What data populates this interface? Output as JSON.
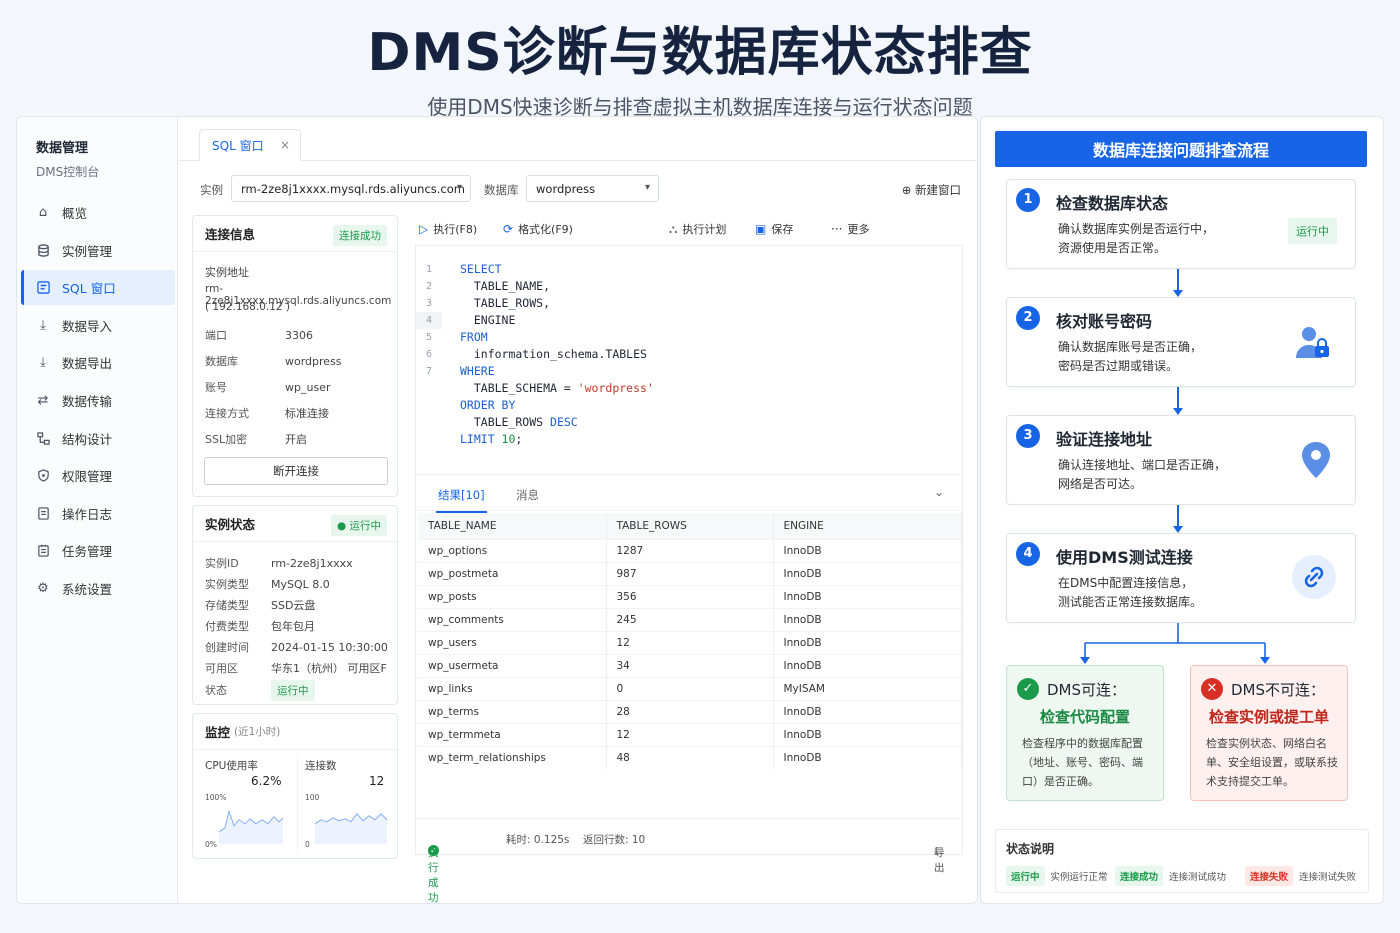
{
  "header": {
    "title": "DMS诊断与数据库状态排查",
    "subtitle": "使用DMS快速诊断与排查虚拟主机数据库连接与运行状态问题"
  },
  "sidebar": {
    "title": "数据管理",
    "subtitle": "DMS控制台",
    "items": [
      {
        "label": "概览",
        "icon": "home-icon"
      },
      {
        "label": "实例管理",
        "icon": "database-icon"
      },
      {
        "label": "SQL 窗口",
        "icon": "sql-window-icon",
        "active": true
      },
      {
        "label": "数据导入",
        "icon": "import-icon"
      },
      {
        "label": "数据导出",
        "icon": "export-icon"
      },
      {
        "label": "数据传输",
        "icon": "transfer-icon"
      },
      {
        "label": "结构设计",
        "icon": "structure-icon"
      },
      {
        "label": "权限管理",
        "icon": "permission-icon"
      },
      {
        "label": "操作日志",
        "icon": "log-icon"
      },
      {
        "label": "任务管理",
        "icon": "task-icon"
      },
      {
        "label": "系统设置",
        "icon": "gear-icon"
      }
    ]
  },
  "tab": {
    "label": "SQL 窗口",
    "close": "×"
  },
  "selectors": {
    "instance_label": "实例",
    "instance_value": "rm-2ze8j1xxxx.mysql.rds.aliyuncs.com",
    "db_label": "数据库",
    "db_value": "wordpress",
    "new_window": "新建窗口"
  },
  "connection": {
    "title": "连接信息",
    "badge": "连接成功",
    "addr_label": "实例地址",
    "addr_value": "rm-2ze8j1xxxx.mysql.rds.aliyuncs.com",
    "addr_ip": "( 192.168.0.12 )",
    "rows": [
      {
        "k": "端口",
        "v": "3306"
      },
      {
        "k": "数据库",
        "v": "wordpress"
      },
      {
        "k": "账号",
        "v": "wp_user"
      },
      {
        "k": "连接方式",
        "v": "标准连接"
      },
      {
        "k": "SSL加密",
        "v": "开启"
      }
    ],
    "disconnect": "断开连接"
  },
  "instance_status": {
    "title": "实例状态",
    "badge": "运行中",
    "rows": [
      {
        "k": "实例ID",
        "v": "rm-2ze8j1xxxx"
      },
      {
        "k": "实例类型",
        "v": "MySQL 8.0"
      },
      {
        "k": "存储类型",
        "v": "SSD云盘"
      },
      {
        "k": "付费类型",
        "v": "包年包月"
      },
      {
        "k": "创建时间",
        "v": "2024-01-15 10:30:00"
      },
      {
        "k": "可用区",
        "v": "华东1（杭州） 可用区F"
      },
      {
        "k": "状态",
        "v": "运行中"
      }
    ]
  },
  "monitor": {
    "title": "监控",
    "range": "(近1小时)",
    "cpu_label": "CPU使用率",
    "cpu_value": "6.2%",
    "cpu_max": "100%",
    "cpu_min": "0%",
    "conn_label": "连接数",
    "conn_value": "12",
    "conn_max": "100",
    "conn_min": "0"
  },
  "toolbar": {
    "run": "执行(F8)",
    "format": "格式化(F9)",
    "plan": "执行计划",
    "save": "保存",
    "more": "更多"
  },
  "editor": {
    "line_numbers": [
      "1",
      "2",
      "3",
      "4",
      "5",
      "6",
      "7"
    ]
  },
  "results": {
    "tab_active": "结果[10]",
    "tab_msg": "消息",
    "columns": [
      "TABLE_NAME",
      "TABLE_ROWS",
      "ENGINE"
    ],
    "rows": [
      [
        "wp_options",
        "1287",
        "InnoDB"
      ],
      [
        "wp_postmeta",
        "987",
        "InnoDB"
      ],
      [
        "wp_posts",
        "356",
        "InnoDB"
      ],
      [
        "wp_comments",
        "245",
        "InnoDB"
      ],
      [
        "wp_users",
        "12",
        "InnoDB"
      ],
      [
        "wp_usermeta",
        "34",
        "InnoDB"
      ],
      [
        "wp_links",
        "0",
        "MyISAM"
      ],
      [
        "wp_terms",
        "28",
        "InnoDB"
      ],
      [
        "wp_termmeta",
        "12",
        "InnoDB"
      ],
      [
        "wp_term_relationships",
        "48",
        "InnoDB"
      ]
    ],
    "status_ok": "执行成功",
    "elapsed": "耗时: 0.125s",
    "row_count": "返回行数: 10",
    "export": "导出"
  },
  "flow": {
    "title": "数据库连接问题排查流程",
    "steps": [
      {
        "num": "1",
        "title": "检查数据库状态",
        "desc1": "确认数据库实例是否运行中，",
        "desc2": "资源使用是否正常。",
        "badge": "运行中"
      },
      {
        "num": "2",
        "title": "核对账号密码",
        "desc1": "确认数据库账号是否正确，",
        "desc2": "密码是否过期或错误。"
      },
      {
        "num": "3",
        "title": "验证连接地址",
        "desc1": "确认连接地址、端口是否正确，",
        "desc2": "网络是否可达。"
      },
      {
        "num": "4",
        "title": "使用DMS测试连接",
        "desc1": "在DMS中配置连接信息，",
        "desc2": "测试能否正常连接数据库。"
      }
    ],
    "ok": {
      "title": "DMS可连：",
      "sub": "检查代码配置",
      "desc": "检查程序中的数据库配置（地址、账号、密码、端口）是否正确。"
    },
    "bad": {
      "title": "DMS不可连：",
      "sub": "检查实例或提工单",
      "desc": "检查实例状态、网络白名单、安全组设置，或联系技术支持提交工单。"
    },
    "legend": {
      "title": "状态说明",
      "items": [
        {
          "tag": "运行中",
          "desc": "实例运行正常"
        },
        {
          "tag": "连接成功",
          "desc": "连接测试成功"
        },
        {
          "tag": "连接失败",
          "desc": "连接测试失败"
        }
      ]
    }
  },
  "colors": {
    "accent": "#1765e6",
    "success": "#1a9a4a",
    "danger": "#d93025"
  }
}
